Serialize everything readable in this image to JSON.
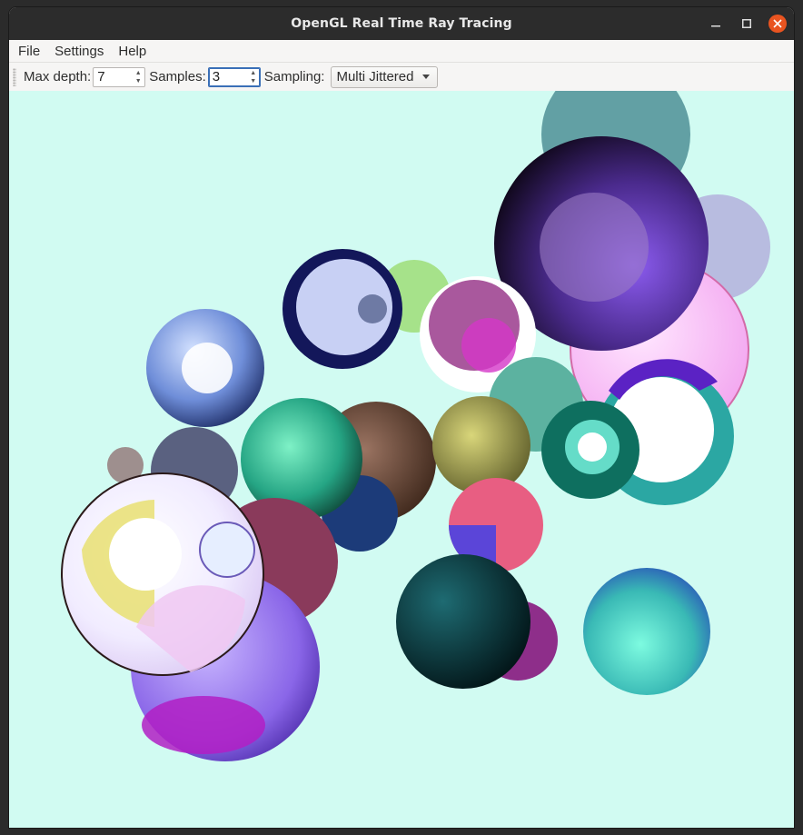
{
  "window": {
    "title": "OpenGL Real Time Ray Tracing"
  },
  "menu": {
    "file": "File",
    "settings": "Settings",
    "help": "Help"
  },
  "toolbar": {
    "max_depth_label": "Max depth:",
    "max_depth_value": "7",
    "samples_label": "Samples:",
    "samples_value": "3",
    "sampling_label": "Sampling:",
    "sampling_selected": "Multi Jittered"
  },
  "colors": {
    "background": "#d1fbf2",
    "titlebar": "#2c2c2c",
    "close_button": "#e95420"
  },
  "icons": {
    "minimize": "minimize-icon",
    "maximize": "maximize-icon",
    "close": "close-icon"
  }
}
